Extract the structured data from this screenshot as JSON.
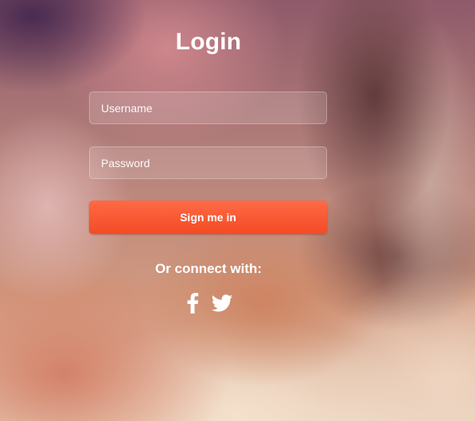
{
  "login": {
    "title": "Login",
    "username_placeholder": "Username",
    "password_placeholder": "Password",
    "signin_label": "Sign me in",
    "connect_label": "Or connect with:",
    "social": [
      {
        "name": "facebook",
        "icon": "facebook-icon"
      },
      {
        "name": "twitter",
        "icon": "twitter-icon"
      }
    ]
  },
  "colors": {
    "button": "#f45a33",
    "text": "#ffffff"
  }
}
